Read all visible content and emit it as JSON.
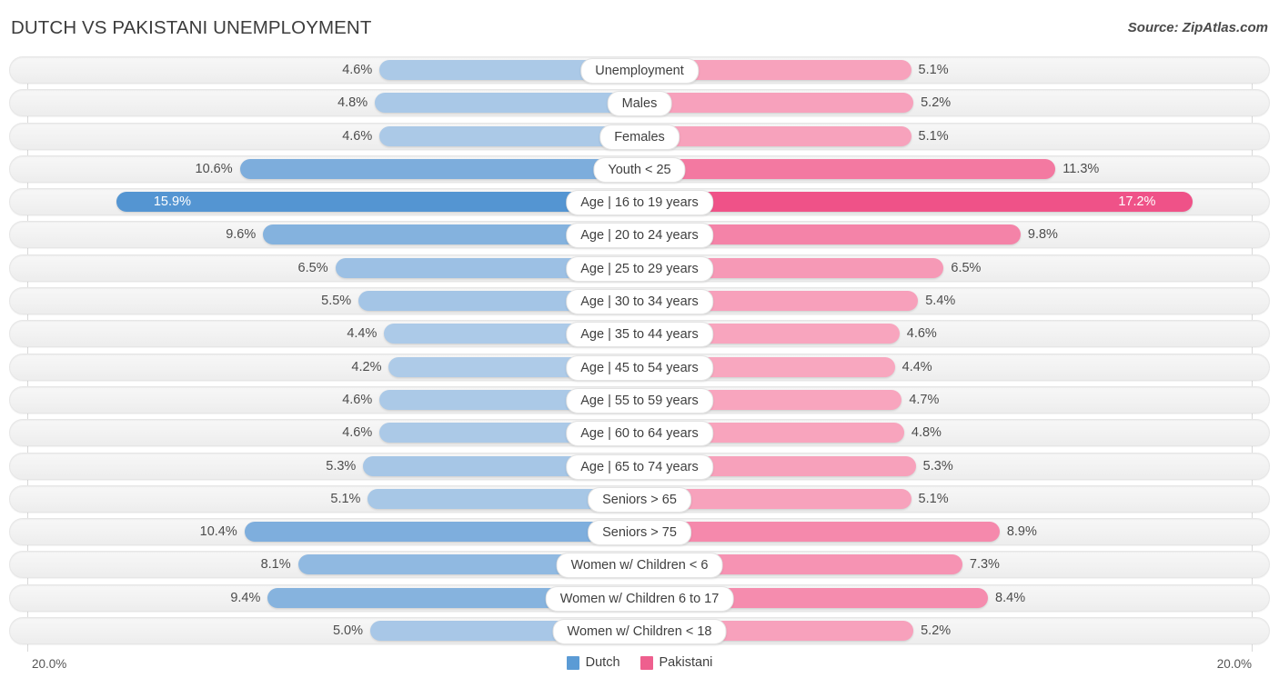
{
  "header": {
    "title": "DUTCH VS PAKISTANI UNEMPLOYMENT",
    "source": "Source: ZipAtlas.com"
  },
  "axis": {
    "min_label": "20.0%",
    "max_label": "20.0%"
  },
  "legend": {
    "items": [
      {
        "label": "Dutch",
        "color": "#5b9bd5",
        "icon": "legend-swatch-dutch"
      },
      {
        "label": "Pakistani",
        "color": "#ee5f8e",
        "icon": "legend-swatch-pakistani"
      }
    ]
  },
  "chart_data": {
    "type": "bar",
    "orientation": "horizontal-diverging",
    "title": "DUTCH VS PAKISTANI UNEMPLOYMENT",
    "xlabel": "",
    "ylabel": "",
    "axis_max_percent": 20.0,
    "grid": true,
    "legend_position": "bottom-center",
    "categories": [
      "Unemployment",
      "Males",
      "Females",
      "Youth < 25",
      "Age | 16 to 19 years",
      "Age | 20 to 24 years",
      "Age | 25 to 29 years",
      "Age | 30 to 34 years",
      "Age | 35 to 44 years",
      "Age | 45 to 54 years",
      "Age | 55 to 59 years",
      "Age | 60 to 64 years",
      "Age | 65 to 74 years",
      "Seniors > 65",
      "Seniors > 75",
      "Women w/ Children < 6",
      "Women w/ Children 6 to 17",
      "Women w/ Children < 18"
    ],
    "series": [
      {
        "name": "Dutch",
        "color": "#5b9bd5",
        "side": "left",
        "values": [
          4.6,
          4.8,
          4.6,
          10.6,
          15.9,
          9.6,
          6.5,
          5.5,
          4.4,
          4.2,
          4.6,
          4.6,
          5.3,
          5.1,
          10.4,
          8.1,
          9.4,
          5.0
        ],
        "labels": [
          "4.6%",
          "4.8%",
          "4.6%",
          "10.6%",
          "15.9%",
          "9.6%",
          "6.5%",
          "5.5%",
          "4.4%",
          "4.2%",
          "4.6%",
          "4.6%",
          "5.3%",
          "5.1%",
          "10.4%",
          "8.1%",
          "9.4%",
          "5.0%"
        ]
      },
      {
        "name": "Pakistani",
        "color": "#ee5f8e",
        "side": "right",
        "values": [
          5.1,
          5.2,
          5.1,
          11.3,
          17.2,
          9.8,
          6.5,
          5.4,
          4.6,
          4.4,
          4.7,
          4.8,
          5.3,
          5.1,
          8.9,
          7.3,
          8.4,
          5.2
        ],
        "labels": [
          "5.1%",
          "5.2%",
          "5.1%",
          "11.3%",
          "17.2%",
          "9.8%",
          "6.5%",
          "5.4%",
          "4.6%",
          "4.4%",
          "4.7%",
          "4.8%",
          "5.3%",
          "5.1%",
          "8.9%",
          "7.3%",
          "8.4%",
          "5.2%"
        ]
      }
    ]
  }
}
